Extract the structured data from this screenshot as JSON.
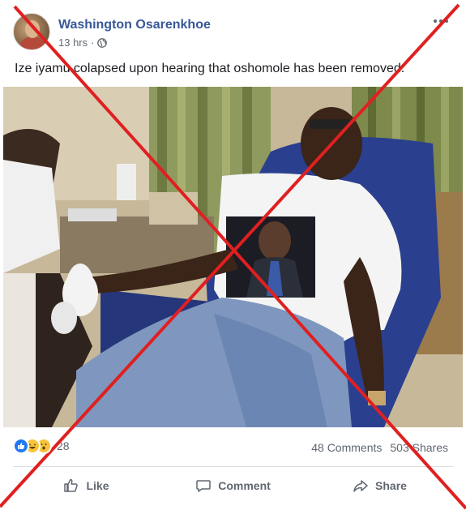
{
  "post": {
    "author": "Washington Osarenkhoe",
    "time": "13 hrs",
    "separator": "·",
    "caption": "Ize iyamu colapsed upon hearing that oshomole has been removed.",
    "icons": {
      "privacy": "globe-icon",
      "more": "more-options-icon"
    }
  },
  "engagement": {
    "reaction_count": "28",
    "reactions": [
      "like-icon",
      "haha-icon",
      "wow-icon"
    ],
    "comments": "48 Comments",
    "shares": "503 Shares"
  },
  "actions": {
    "like_label": "Like",
    "comment_label": "Comment",
    "share_label": "Share"
  },
  "overlay": {
    "mark": "red-x-overlay",
    "color": "#e02020"
  },
  "colors": {
    "author_link": "#385898",
    "like_blue": "#2078f4",
    "secondary_text": "#606770"
  }
}
